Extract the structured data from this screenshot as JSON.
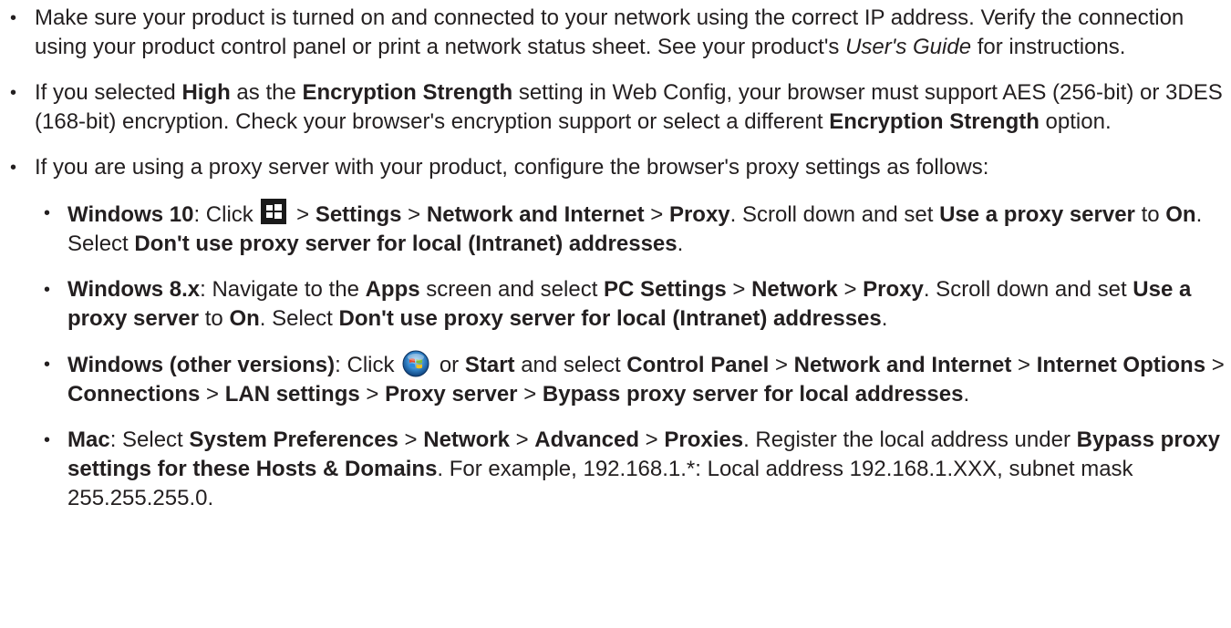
{
  "bullet_glyph": "•",
  "items": [
    {
      "t0": "Make sure your product is turned on and connected to your network using the correct IP address. Verify the connection using your product control panel or print a network status sheet. See your product's ",
      "t1": "User's Guide",
      "t2": " for instructions."
    },
    {
      "t0": "If you selected ",
      "b0": "High",
      "t1": " as the ",
      "b1": "Encryption Strength",
      "t2": " setting in Web Config, your browser must support AES (256-bit) or 3DES (168-bit) encryption. Check your browser's encryption support or select a different ",
      "b2": "Encryption Strength",
      "t3": " option."
    },
    {
      "t0": "If you are using a proxy server with your product, configure the browser's proxy settings as follows:",
      "sub": [
        {
          "b0": "Windows 10",
          "t0": ": Click ",
          "t1": " > ",
          "b1": "Settings",
          "t2": " > ",
          "b2": "Network and Internet",
          "t3": " > ",
          "b3": "Proxy",
          "t4": ". Scroll down and set ",
          "b4": "Use a proxy server",
          "t5": " to ",
          "b5": "On",
          "t6": ". Select ",
          "b6": "Don't use proxy server for local (Intranet) addresses",
          "t7": "."
        },
        {
          "b0": "Windows 8.x",
          "t0": ": Navigate to the ",
          "b1": "Apps",
          "t1": " screen and select ",
          "b2": "PC Settings",
          "t2": " > ",
          "b3": "Network",
          "t3": " > ",
          "b4": "Proxy",
          "t4": ". Scroll down and set ",
          "b5": "Use a proxy server",
          "t5": " to ",
          "b6": "On",
          "t6": ". Select ",
          "b7": "Don't use proxy server for local (Intranet) addresses",
          "t7": "."
        },
        {
          "b0": "Windows (other versions)",
          "t0": ": Click ",
          "t1": " or ",
          "b1": "Start",
          "t2": " and select ",
          "b2": "Control Panel",
          "t3": " > ",
          "b3": "Network and Internet",
          "t4": " > ",
          "b4": "Internet Options",
          "t5": " > ",
          "b5": "Connections",
          "t6": " > ",
          "b6": "LAN settings",
          "t7": " > ",
          "b7": "Proxy server",
          "t8": " > ",
          "b8": "Bypass proxy server for local addresses",
          "t9": "."
        },
        {
          "b0": "Mac",
          "t0": ": Select ",
          "b1": "System Preferences",
          "t1": " > ",
          "b2": "Network",
          "t2": " > ",
          "b3": "Advanced",
          "t3": " > ",
          "b4": "Proxies",
          "t4": ". Register the local address under ",
          "b5": "Bypass proxy settings for these Hosts & Domains",
          "t5": ". For example, 192.168.1.*: Local address 192.168.1.XXX, subnet mask 255.255.255.0."
        }
      ]
    }
  ]
}
